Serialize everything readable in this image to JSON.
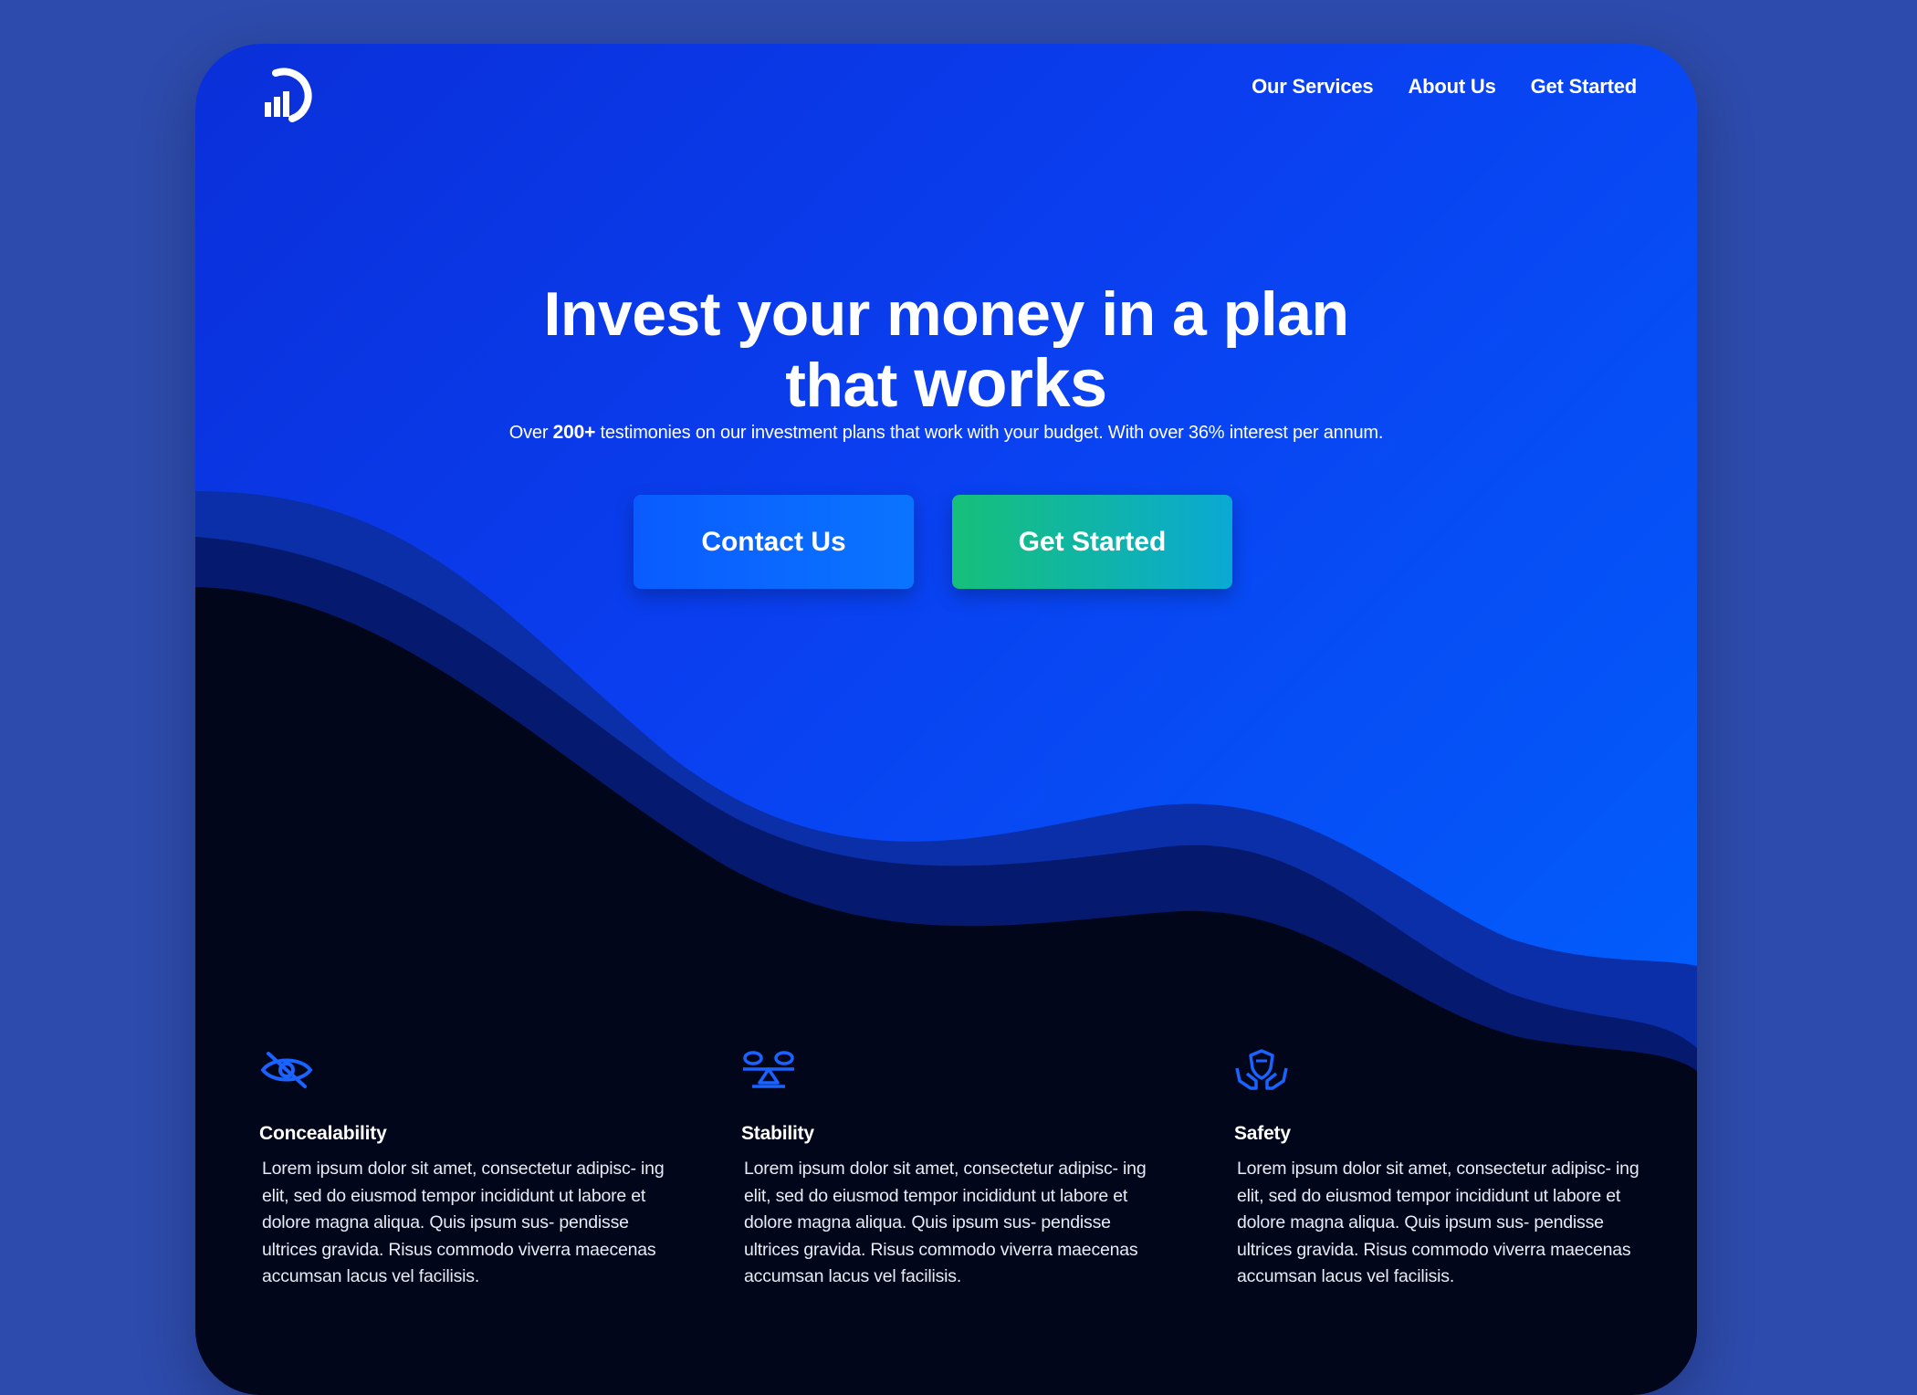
{
  "colors": {
    "page_background": "#2d4bac",
    "hero_gradient_start": "#0a2fd9",
    "hero_gradient_end": "#0066ff",
    "dark_section": "#02061a",
    "icon_accent": "#1a63ff",
    "contact_button": "#0a66ff",
    "get_started_gradient": [
      "#16c079",
      "#0aa9d4"
    ]
  },
  "logo": {
    "icon": "chart-arc-logo-icon"
  },
  "nav": {
    "items": [
      {
        "label": "Our Services"
      },
      {
        "label": "About Us"
      },
      {
        "label": "Get Started"
      }
    ]
  },
  "hero": {
    "title_line1": "Invest your money in a plan",
    "title_line2_prefix": "that ",
    "title_line2_emphasis": "works",
    "subtitle_prefix": "Over ",
    "subtitle_bold": "200+",
    "subtitle_suffix": " testimonies on our investment plans that work with your budget. With over 36% interest per annum.",
    "buttons": {
      "contact": "Contact Us",
      "get_started": "Get Started"
    }
  },
  "features": [
    {
      "icon": "eye-slash-icon",
      "title": "Concealability",
      "body": "Lorem ipsum dolor sit amet, consectetur adipisc- ing elit, sed do eiusmod tempor incididunt ut labore et dolore magna aliqua. Quis ipsum sus- pendisse ultrices gravida. Risus commodo viverra maecenas accumsan lacus vel facilisis."
    },
    {
      "icon": "balance-scale-icon",
      "title": "Stability",
      "body": "Lorem ipsum dolor sit amet, consectetur adipisc- ing elit, sed do eiusmod tempor incididunt ut labore et dolore magna aliqua. Quis ipsum sus- pendisse ultrices gravida. Risus commodo viverra maecenas accumsan lacus vel facilisis."
    },
    {
      "icon": "shield-hands-icon",
      "title": "Safety",
      "body": "Lorem ipsum dolor sit amet, consectetur adipisc- ing elit, sed do eiusmod tempor incididunt ut labore et dolore magna aliqua. Quis ipsum sus- pendisse ultrices gravida. Risus commodo viverra maecenas accumsan lacus vel facilisis."
    }
  ]
}
